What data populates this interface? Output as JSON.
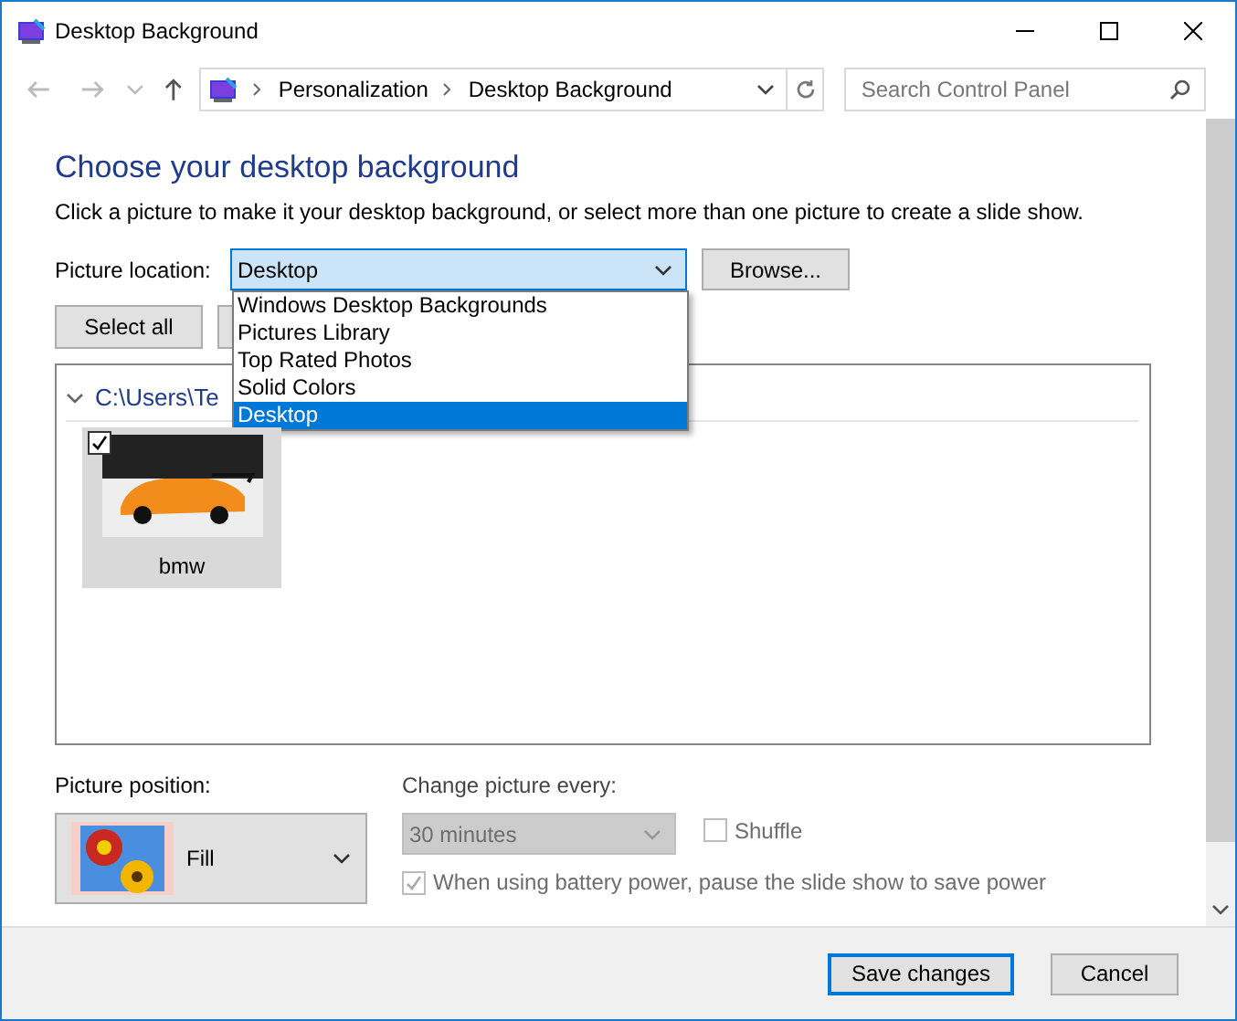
{
  "window": {
    "title": "Desktop Background"
  },
  "nav": {
    "breadcrumb": [
      "Personalization",
      "Desktop Background"
    ],
    "search_placeholder": "Search Control Panel"
  },
  "heading": "Choose your desktop background",
  "description": "Click a picture to make it your desktop background, or select more than one picture to create a slide show.",
  "location": {
    "label": "Picture location:",
    "value": "Desktop",
    "expanded": true,
    "options": [
      {
        "label": "Windows Desktop Backgrounds",
        "selected": false
      },
      {
        "label": "Pictures Library",
        "selected": false
      },
      {
        "label": "Top Rated Photos",
        "selected": false
      },
      {
        "label": "Solid Colors",
        "selected": false
      },
      {
        "label": "Desktop",
        "selected": true
      }
    ]
  },
  "browse_button": "Browse...",
  "select_all_button": "Select all",
  "folder": {
    "label": "C:\\Users\\Te",
    "expanded": true,
    "pictures": [
      {
        "label": "bmw",
        "checked": true,
        "selected": true
      }
    ]
  },
  "position": {
    "label": "Picture position:",
    "value": "Fill"
  },
  "interval": {
    "label": "Change picture every:",
    "value": "30 minutes",
    "disabled": true
  },
  "shuffle": {
    "label": "Shuffle",
    "checked": false,
    "disabled": true
  },
  "battery": {
    "label": "When using battery power, pause the slide show to save power",
    "checked": true,
    "disabled": true
  },
  "buttons": [
    {
      "label": "Save changes",
      "default": true
    },
    {
      "label": "Cancel",
      "default": false
    }
  ]
}
